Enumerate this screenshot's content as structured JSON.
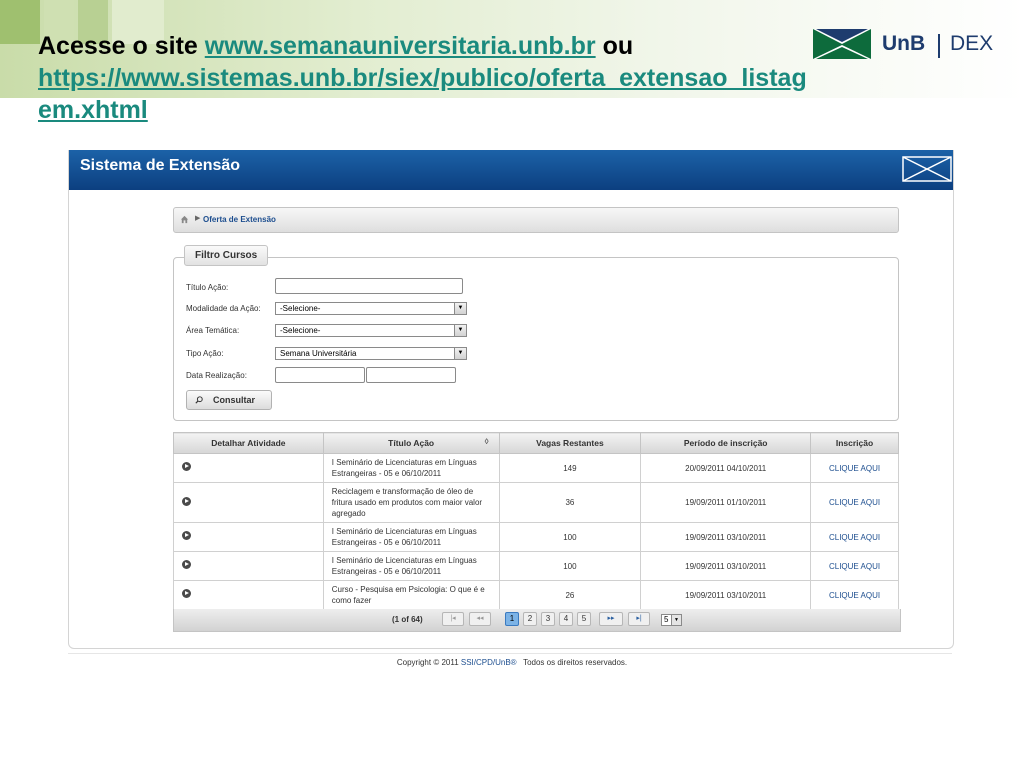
{
  "slide": {
    "title_prefix": "Acesse o site ",
    "link1": "www.semanauniversitaria.unb.br",
    "title_middle": " ou",
    "link2": "https://www.sistemas.unb.br/siex/publico/oferta_extensao_listagem.xhtml",
    "logo": {
      "name": "UnB",
      "dept": "DEX"
    }
  },
  "app": {
    "title": "Sistema de Extensão",
    "breadcrumb": {
      "current": "Oferta de Extensão"
    },
    "filter": {
      "legend": "Filtro Cursos",
      "titulo_label": "Título Ação:",
      "titulo_value": "",
      "modalidade_label": "Modalidade da Ação:",
      "modalidade_value": "-Selecione-",
      "area_label": "Área Temática:",
      "area_value": "-Selecione-",
      "tipo_label": "Tipo Ação:",
      "tipo_value": "Semana Universitária",
      "data_label": "Data Realização:",
      "data_inicio": "",
      "data_fim": "",
      "consultar": "Consultar"
    },
    "table": {
      "headers": [
        "Detalhar Atividade",
        "Título Ação",
        "Vagas Restantes",
        "Período de inscrição",
        "Inscrição"
      ],
      "rows": [
        {
          "titulo": "I Seminário de Licenciaturas em Línguas Estrangeiras - 05 e 06/10/2011",
          "vagas": "149",
          "periodo": "20/09/2011  04/10/2011",
          "inscricao": "CLIQUE AQUI"
        },
        {
          "titulo": "Reciclagem e transformação de óleo de fritura usado em produtos com maior valor agregado",
          "vagas": "36",
          "periodo": "19/09/2011  01/10/2011",
          "inscricao": "CLIQUE AQUI"
        },
        {
          "titulo": "I Seminário de Licenciaturas em Línguas Estrangeiras - 05 e 06/10/2011",
          "vagas": "100",
          "periodo": "19/09/2011  03/10/2011",
          "inscricao": "CLIQUE AQUI"
        },
        {
          "titulo": "I Seminário de Licenciaturas em Línguas Estrangeiras - 05 e 06/10/2011",
          "vagas": "100",
          "periodo": "19/09/2011  03/10/2011",
          "inscricao": "CLIQUE AQUI"
        },
        {
          "titulo": "Curso - Pesquisa em Psicologia: O que é e como fazer",
          "vagas": "26",
          "periodo": "19/09/2011  03/10/2011",
          "inscricao": "CLIQUE AQUI"
        }
      ]
    },
    "pager": {
      "info": "(1 of 64)",
      "pages": [
        "1",
        "2",
        "3",
        "4",
        "5"
      ],
      "current_page": 1,
      "rows_per_page": "5"
    }
  },
  "footer": {
    "text_prefix": "Copyright © 2011 ",
    "link": "SSI/CPD/UnB®",
    "text_suffix": "   Todos os direitos reservados."
  },
  "colors": {
    "header_blue": "#0c3f80",
    "link_teal": "#1a8a7e",
    "unb_green": "#0d6b3c",
    "unb_navy": "#1e3c6e"
  }
}
